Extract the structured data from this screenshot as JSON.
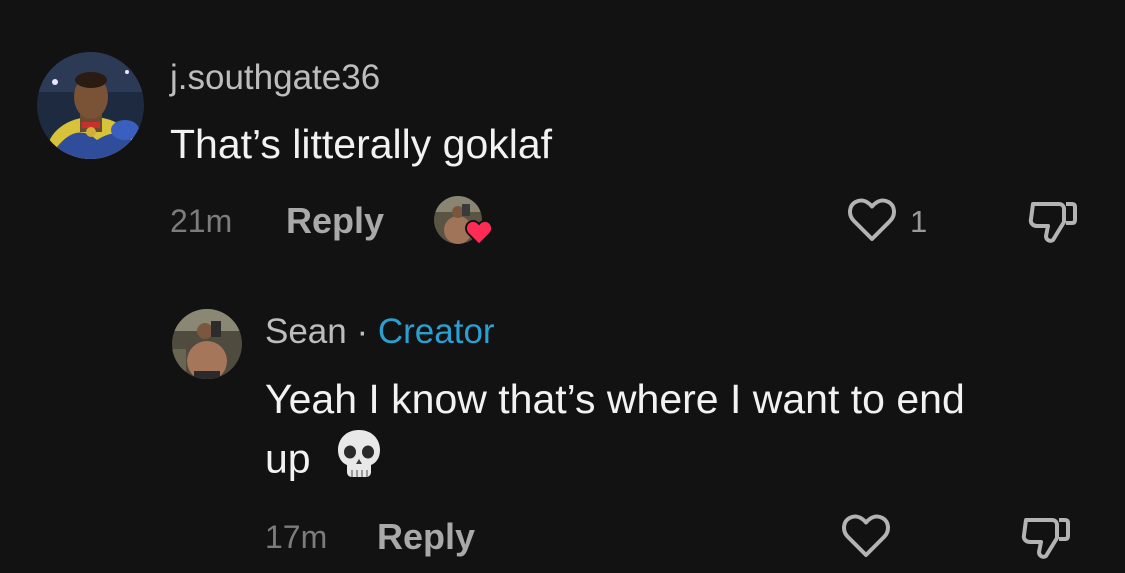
{
  "comment": {
    "username": "j.southgate36",
    "text": "That’s litterally goklaf",
    "time": "21m",
    "reply_label": "Reply",
    "like_count": "1",
    "creator_liked": true,
    "avatar_icon": "player-photo-avatar"
  },
  "reply": {
    "username": "Sean",
    "separator": "·",
    "badge": "Creator",
    "text_line1": "Yeah I know that’s where I want to end",
    "text_line2": "up",
    "emoji_icon": "skull-emoji",
    "time": "17m",
    "reply_label": "Reply",
    "avatar_icon": "mirror-selfie-avatar"
  },
  "colors": {
    "background": "#121212",
    "creator_badge": "#2a9fd0",
    "heart_badge": "#fe2c55"
  }
}
